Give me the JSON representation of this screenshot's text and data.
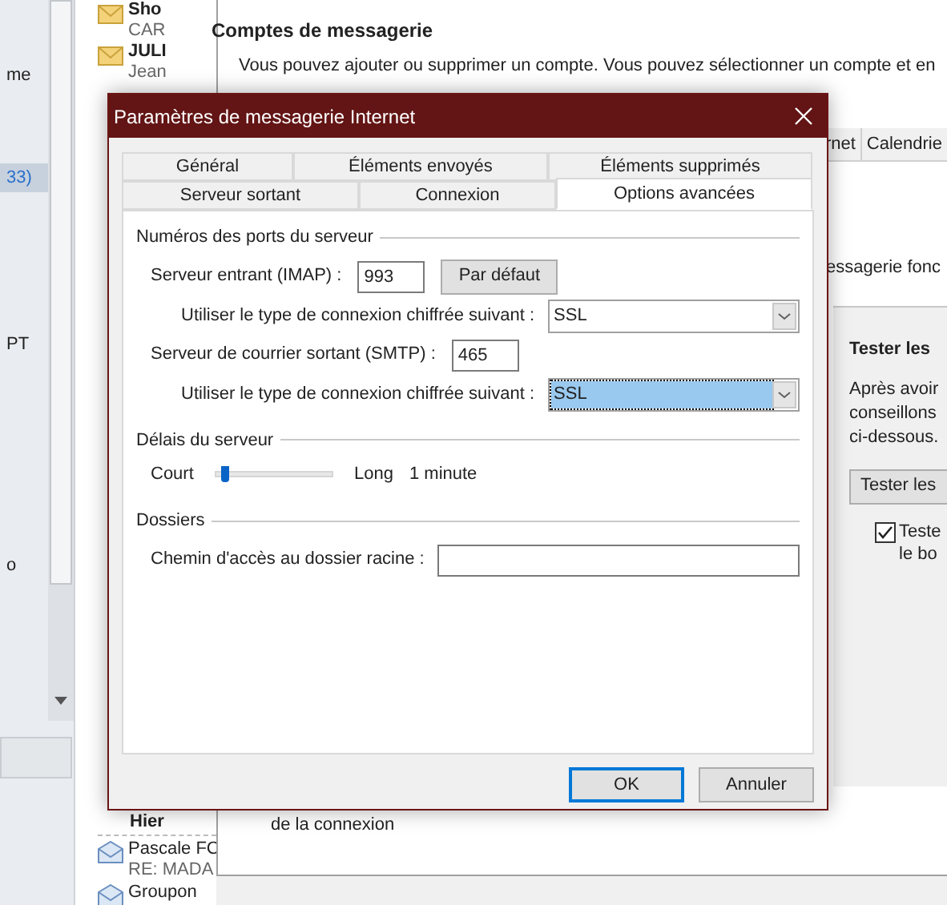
{
  "folder_pane": {
    "items": [
      {
        "label": "me",
        "selected": false
      },
      {
        "label": "33)",
        "selected": true
      },
      {
        "label": "PT",
        "selected": false
      },
      {
        "label": "o",
        "selected": false
      }
    ]
  },
  "message_list": {
    "top_items": [
      {
        "sender": "Sho",
        "subject": "CAR"
      },
      {
        "sender": "JULI",
        "subject": "Jean"
      }
    ],
    "group_header": "Hier",
    "bottom_items": [
      {
        "sender": "Pascale FC",
        "subject": "RE: MADA"
      },
      {
        "sender": "Groupon"
      }
    ]
  },
  "account_settings": {
    "title": "Comptes de messagerie",
    "description": "Vous pouvez ajouter ou supprimer un compte. Vous pouvez sélectionner un compte et en",
    "tabs": [
      {
        "label": "rnet",
        "selected": false
      },
      {
        "label": "Calendrie",
        "selected": false
      }
    ],
    "status_text": "essagerie fonc",
    "test_panel": {
      "heading": "Tester les",
      "lines": [
        "Après avoir",
        "conseillons",
        "ci-dessous."
      ],
      "button": "Tester les",
      "checkbox": {
        "label_lines": [
          "Teste",
          "le bo"
        ],
        "checked": true
      }
    },
    "footer_text": "de la connexion"
  },
  "dialog": {
    "title": "Paramètres de messagerie Internet",
    "tab_rows": [
      [
        {
          "label": "Général",
          "selected": false
        },
        {
          "label": "Éléments envoyés",
          "selected": false
        },
        {
          "label": "Éléments supprimés",
          "selected": false
        }
      ],
      [
        {
          "label": "Serveur sortant",
          "selected": false
        },
        {
          "label": "Connexion",
          "selected": false
        },
        {
          "label": "Options avancées",
          "selected": true
        }
      ]
    ],
    "ports_group": "Numéros des ports du serveur",
    "incoming_label": "Serveur entrant (IMAP) :",
    "incoming_port": "993",
    "default_button": "Par défaut",
    "incoming_encryption": {
      "label": "Utiliser le type de connexion chiffrée suivant :",
      "value": "SSL",
      "focused": false
    },
    "outgoing_label": "Serveur de courrier sortant (SMTP) :",
    "outgoing_port": "465",
    "outgoing_encryption": {
      "label": "Utiliser le type de connexion chiffrée suivant :",
      "value": "SSL",
      "focused": true
    },
    "timeout_group": "Délais du serveur",
    "timeout": {
      "min_label": "Court",
      "max_label": "Long",
      "level": 0.05,
      "reading": "1 minute"
    },
    "folders_group": "Dossiers",
    "root_folder_label": "Chemin d'accès au dossier racine :",
    "buttons": [
      {
        "label": "OK",
        "default": true
      },
      {
        "label": "Annuler",
        "default": false
      }
    ]
  }
}
